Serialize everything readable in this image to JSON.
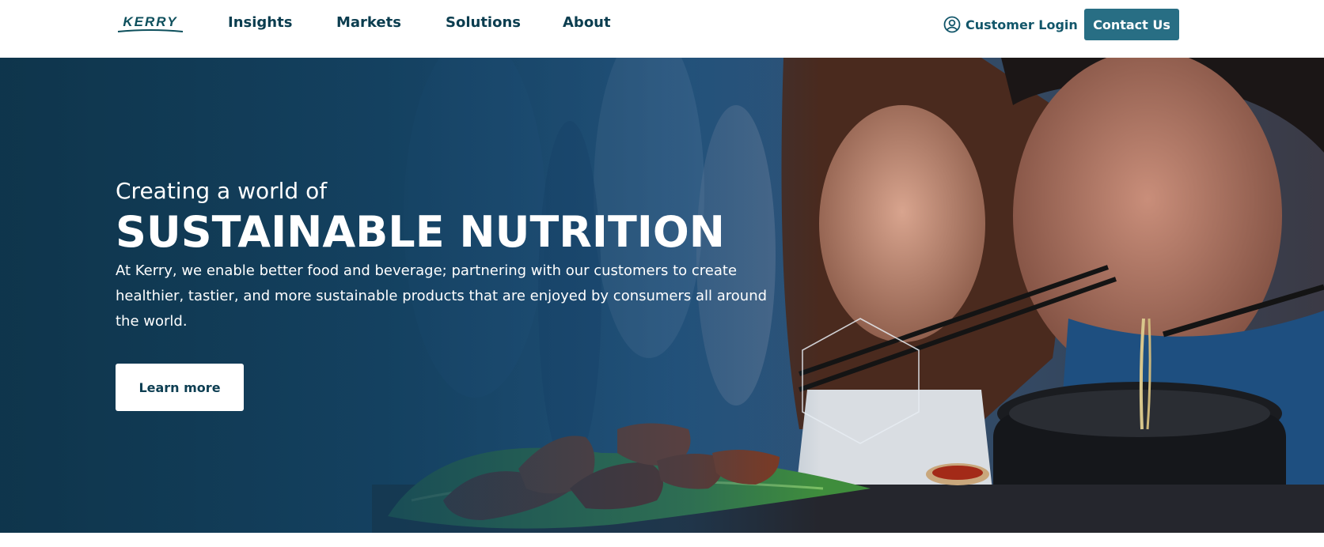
{
  "header": {
    "logo_text": "KERRY",
    "nav": [
      {
        "label": "Insights"
      },
      {
        "label": "Markets"
      },
      {
        "label": "Solutions"
      },
      {
        "label": "About"
      }
    ],
    "login_label": "Customer Login",
    "contact_label": "Contact Us"
  },
  "hero": {
    "kicker": "Creating a world of",
    "title": "SUSTAINABLE NUTRITION",
    "body": "At Kerry, we enable better food and beverage; partnering with our customers to create healthier, tastier, and more sustainable products that are enjoyed by consumers all around the world.",
    "cta_label": "Learn more"
  },
  "icons": {
    "login": "user-circle-icon",
    "decoration": "hexagon-outline-icon"
  },
  "colors": {
    "brand": "#0b3d4f",
    "contact_button": "#286e84",
    "hero_overlay": "#113e5c",
    "white": "#ffffff"
  }
}
